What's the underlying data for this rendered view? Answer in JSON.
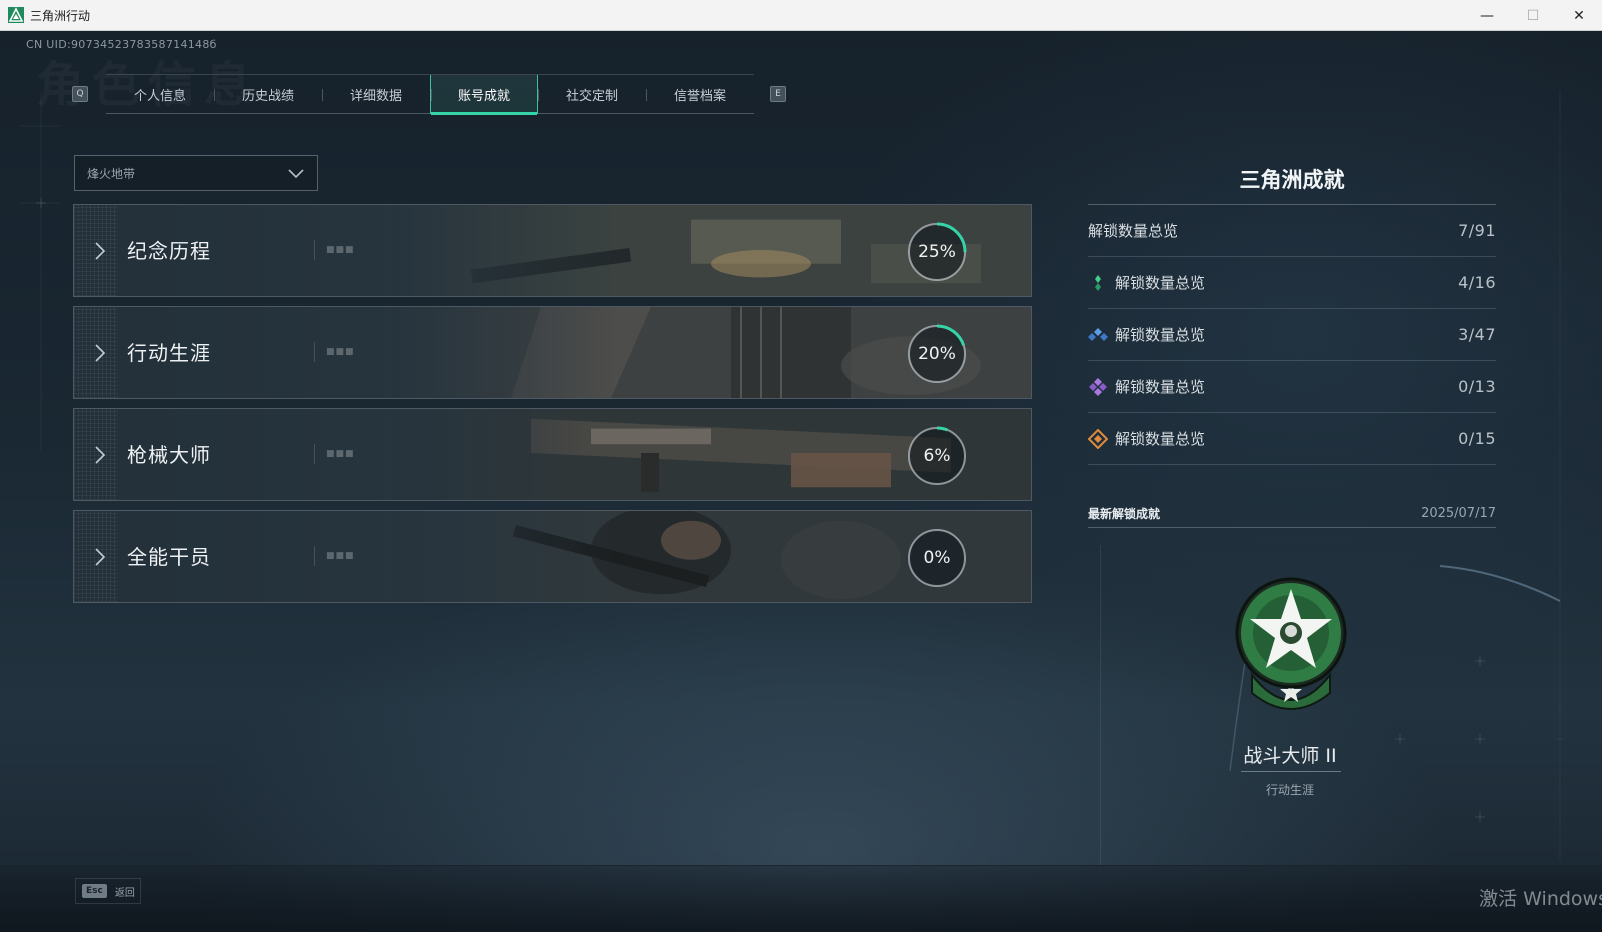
{
  "window": {
    "title": "三角洲行动",
    "minimize": "—",
    "maximize": "☐",
    "close": "✕"
  },
  "account": {
    "uid": "CN UID:9073452378358714148б"
  },
  "tabs": {
    "left_key": "Q",
    "right_key": "E",
    "items": [
      {
        "label": "个人信息",
        "active": false
      },
      {
        "label": "历史战绩",
        "active": false
      },
      {
        "label": "详细数据",
        "active": false
      },
      {
        "label": "账号成就",
        "active": true
      },
      {
        "label": "社交定制",
        "active": false
      },
      {
        "label": "信誉档案",
        "active": false
      }
    ]
  },
  "mode_select": {
    "value": "烽火地带"
  },
  "categories": [
    {
      "label": "纪念历程",
      "progress": 25,
      "progress_text": "25%"
    },
    {
      "label": "行动生涯",
      "progress": 20,
      "progress_text": "20%"
    },
    {
      "label": "枪械大师",
      "progress": 6,
      "progress_text": "6%"
    },
    {
      "label": "全能干员",
      "progress": 0,
      "progress_text": "0%"
    }
  ],
  "summary": {
    "title": "三角洲成就",
    "total": {
      "label": "解锁数量总览",
      "count": "7/91"
    },
    "tiers": [
      {
        "label": "解锁数量总览",
        "count": "4/16",
        "icon": "green-diamond-icon",
        "color": "#3fd08a"
      },
      {
        "label": "解锁数量总览",
        "count": "3/47",
        "icon": "blue-diamond-icon",
        "color": "#4f8fe0"
      },
      {
        "label": "解锁数量总览",
        "count": "0/13",
        "icon": "purple-diamond-icon",
        "color": "#9c6ad8"
      },
      {
        "label": "解锁数量总览",
        "count": "0/15",
        "icon": "orange-diamond-icon",
        "color": "#e08a3c"
      }
    ]
  },
  "latest": {
    "label": "最新解锁成就",
    "date": "2025/07/17",
    "achievement_name": "战斗大师 II",
    "achievement_category": "行动生涯"
  },
  "footer": {
    "esc_key": "Esc",
    "back_label": "返回",
    "watermark": "激活 Windows"
  },
  "colors": {
    "accent": "#37d3a8",
    "badge_green": "#2f7d45"
  }
}
